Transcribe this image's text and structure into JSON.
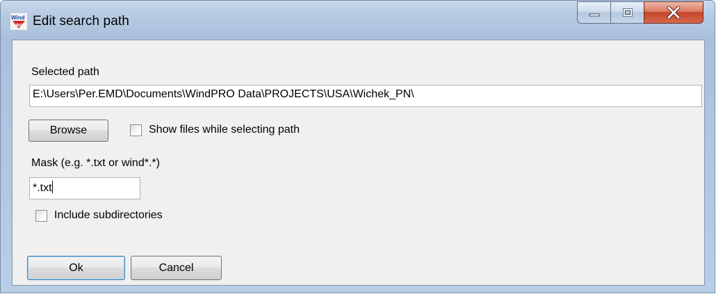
{
  "window": {
    "title": "Edit search path",
    "app_icon": "windpro-logo-icon"
  },
  "caption_buttons": {
    "minimize": "minimize-icon",
    "maximize": "maximize-icon",
    "close": "close-icon"
  },
  "form": {
    "selected_path_label": "Selected path",
    "selected_path_value": "E:\\Users\\Per.EMD\\Documents\\WindPRO Data\\PROJECTS\\USA\\Wichek_PN\\",
    "browse_button": "Browse",
    "show_files_label": "Show files while selecting path",
    "show_files_checked": false,
    "mask_label": "Mask (e.g. *.txt or wind*.*)",
    "mask_value": "*.txt",
    "include_subdirs_label": "Include subdirectories",
    "include_subdirs_checked": false
  },
  "buttons": {
    "ok": "Ok",
    "cancel": "Cancel"
  }
}
